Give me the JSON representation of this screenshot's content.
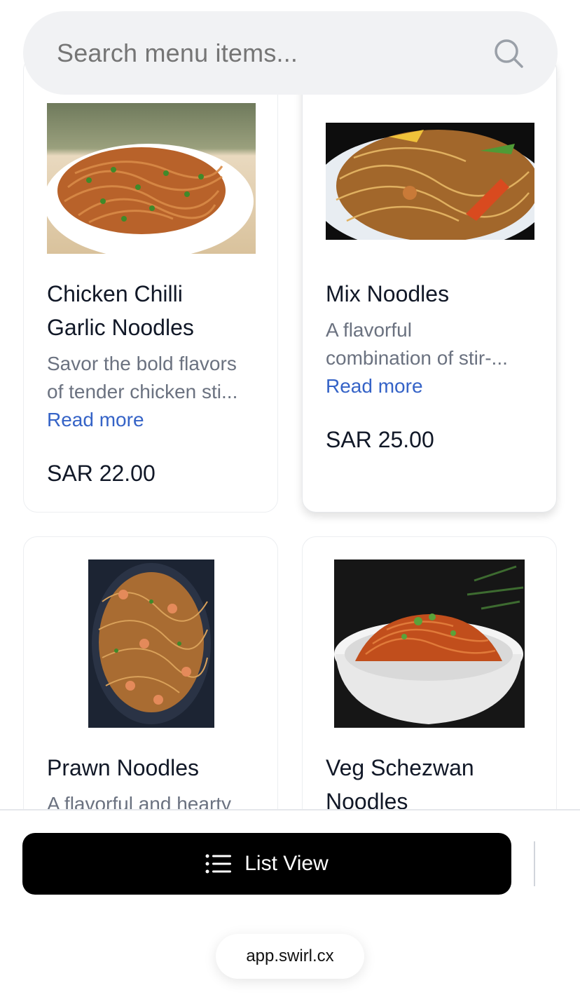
{
  "search": {
    "placeholder": "Search menu items..."
  },
  "items": [
    {
      "title_line1": "Chicken Chilli",
      "title_line2": "Garlic Noodles",
      "desc_line1": "Savor the bold flavors",
      "desc_line2": "of tender chicken sti...",
      "read_more": "Read more",
      "price": "SAR 22.00",
      "image_icon": "noodles-plate-photo"
    },
    {
      "title_line1": "Mix Noodles",
      "desc_line1": "A flavorful",
      "desc_line2": "combination of stir-...",
      "read_more": "Read more",
      "price": "SAR 25.00",
      "image_icon": "mixed-noodles-photo"
    },
    {
      "title_line1": "Prawn Noodles",
      "desc_line1": "A flavorful and hearty",
      "image_icon": "prawn-noodles-photo"
    },
    {
      "title_line1": "Veg Schezwan",
      "title_line2": "Noodles",
      "image_icon": "schezwan-bowl-photo"
    }
  ],
  "footer": {
    "list_view_label": "List View",
    "url": "app.swirl.cx"
  },
  "colors": {
    "accent_link": "#3563c7",
    "button_bg": "#000000",
    "search_bg": "#f1f2f4"
  }
}
